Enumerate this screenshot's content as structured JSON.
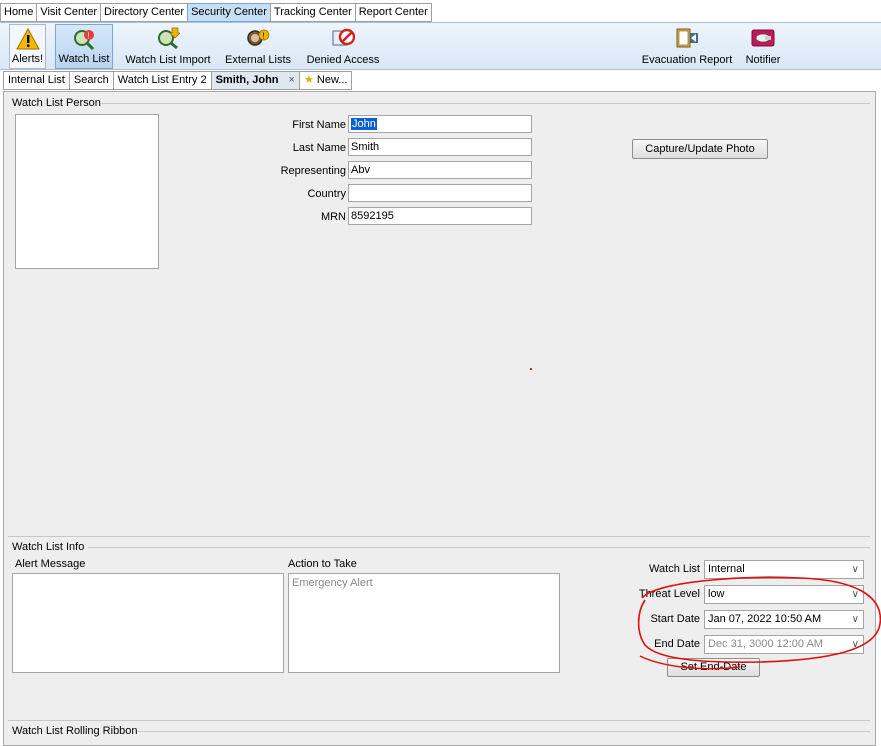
{
  "menu_tabs": [
    "Home",
    "Visit Center",
    "Directory Center",
    "Security Center",
    "Tracking Center",
    "Report Center"
  ],
  "toolbar": {
    "alerts": "Alerts!",
    "watch_list": "Watch List",
    "watch_list_import": "Watch List Import",
    "external_lists": "External Lists",
    "denied_access": "Denied Access",
    "evacuation_report": "Evacuation Report",
    "notifier": "Notifier"
  },
  "doc_tabs": {
    "internal_list": "Internal List",
    "search": "Search",
    "watch_list_entry": "Watch List Entry 2",
    "smith_john": "Smith, John",
    "close": "×",
    "new": "New..."
  },
  "person": {
    "group_title": "Watch List Person",
    "first_name_label": "First Name",
    "first_name": "John",
    "last_name_label": "Last Name",
    "last_name": "Smith",
    "representing_label": "Representing",
    "representing": "Abv",
    "country_label": "Country",
    "country": "",
    "mrn_label": "MRN",
    "mrn": "8592195",
    "capture_button": "Capture/Update Photo"
  },
  "info": {
    "group_title": "Watch List Info",
    "alert_message_label": "Alert Message",
    "alert_message": "",
    "action_label": "Action to Take",
    "action_placeholder": "Emergency Alert",
    "watch_list_label": "Watch List",
    "watch_list_value": "Internal",
    "threat_level_label": "Threat Level",
    "threat_level_value": "low",
    "start_date_label": "Start Date",
    "start_date_value": "Jan 07, 2022 10:50 AM",
    "end_date_label": "End Date",
    "end_date_value": "Dec 31, 3000 12:00 AM",
    "set_end_date_button": "Set End-Date"
  },
  "ribbon": {
    "group_title": "Watch List Rolling Ribbon"
  },
  "colors": {
    "active_tab": "#c7dff5",
    "annotation": "#e01010",
    "selection": "#0a5fcf"
  }
}
